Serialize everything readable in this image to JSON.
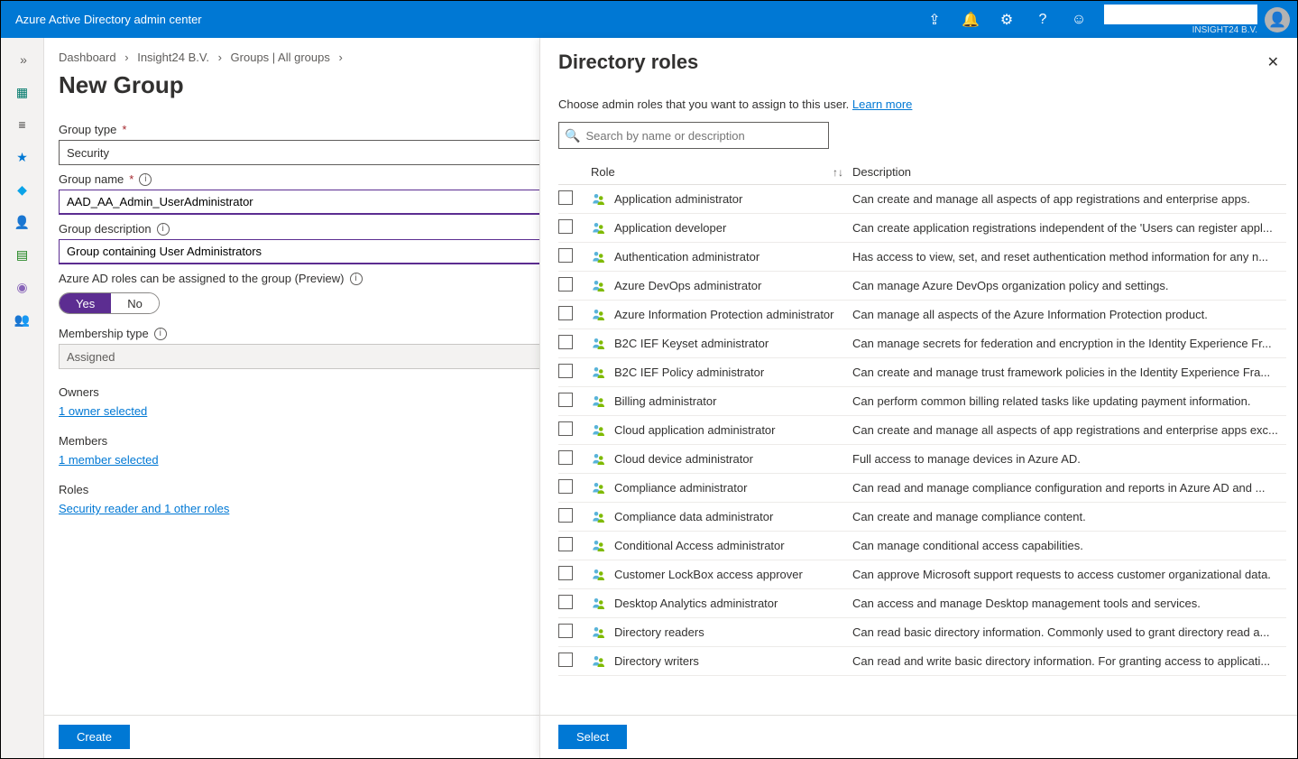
{
  "header": {
    "title": "Azure Active Directory admin center",
    "tenant": "INSIGHT24 B.V."
  },
  "breadcrumb": {
    "items": [
      "Dashboard",
      "Insight24 B.V.",
      "Groups | All groups"
    ]
  },
  "page": {
    "title": "New Group"
  },
  "form": {
    "group_type_label": "Group type",
    "group_type_value": "Security",
    "group_name_label": "Group name",
    "group_name_value": "AAD_AA_Admin_UserAdministrator",
    "group_desc_label": "Group description",
    "group_desc_value": "Group containing User Administrators",
    "roles_assign_label": "Azure AD roles can be assigned to the group (Preview)",
    "toggle_yes": "Yes",
    "toggle_no": "No",
    "membership_type_label": "Membership type",
    "membership_type_value": "Assigned",
    "owners_label": "Owners",
    "owners_link": "1 owner selected",
    "members_label": "Members",
    "members_link": "1 member selected",
    "roles_label": "Roles",
    "roles_link": "Security reader and 1 other roles",
    "create_button": "Create"
  },
  "flyout": {
    "title": "Directory roles",
    "description": "Choose admin roles that you want to assign to this user.",
    "learn_more": "Learn more",
    "search_placeholder": "Search by name or description",
    "col_role": "Role",
    "col_desc": "Description",
    "select_button": "Select",
    "roles": [
      {
        "name": "Application administrator",
        "desc": "Can create and manage all aspects of app registrations and enterprise apps."
      },
      {
        "name": "Application developer",
        "desc": "Can create application registrations independent of the 'Users can register appl..."
      },
      {
        "name": "Authentication administrator",
        "desc": "Has access to view, set, and reset authentication method information for any n..."
      },
      {
        "name": "Azure DevOps administrator",
        "desc": "Can manage Azure DevOps organization policy and settings."
      },
      {
        "name": "Azure Information Protection administrator",
        "desc": "Can manage all aspects of the Azure Information Protection product."
      },
      {
        "name": "B2C IEF Keyset administrator",
        "desc": "Can manage secrets for federation and encryption in the Identity Experience Fr..."
      },
      {
        "name": "B2C IEF Policy administrator",
        "desc": "Can create and manage trust framework policies in the Identity Experience Fra..."
      },
      {
        "name": "Billing administrator",
        "desc": "Can perform common billing related tasks like updating payment information."
      },
      {
        "name": "Cloud application administrator",
        "desc": "Can create and manage all aspects of app registrations and enterprise apps exc..."
      },
      {
        "name": "Cloud device administrator",
        "desc": "Full access to manage devices in Azure AD."
      },
      {
        "name": "Compliance administrator",
        "desc": "Can read and manage compliance configuration and reports in Azure AD and ..."
      },
      {
        "name": "Compliance data administrator",
        "desc": "Can create and manage compliance content."
      },
      {
        "name": "Conditional Access administrator",
        "desc": "Can manage conditional access capabilities."
      },
      {
        "name": "Customer LockBox access approver",
        "desc": "Can approve Microsoft support requests to access customer organizational data."
      },
      {
        "name": "Desktop Analytics administrator",
        "desc": "Can access and manage Desktop management tools and services."
      },
      {
        "name": "Directory readers",
        "desc": "Can read basic directory information. Commonly used to grant directory read a..."
      },
      {
        "name": "Directory writers",
        "desc": "Can read and write basic directory information. For granting access to applicati..."
      }
    ]
  }
}
